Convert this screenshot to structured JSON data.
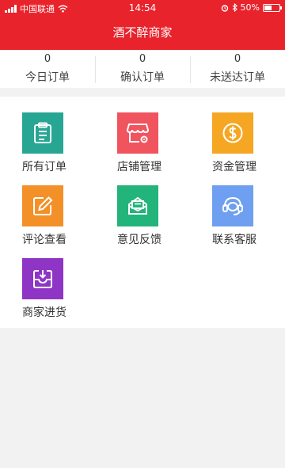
{
  "status_bar": {
    "carrier": "中国联通",
    "time": "14:54",
    "battery": "50%",
    "battery_level": 0.5
  },
  "header": {
    "title": "酒不醉商家"
  },
  "stats": [
    {
      "value": "0",
      "label": "今日订单"
    },
    {
      "value": "0",
      "label": "确认订单"
    },
    {
      "value": "0",
      "label": "未送达订单"
    }
  ],
  "menu": [
    {
      "label": "所有订单",
      "icon": "clipboard-icon",
      "color": "#27a694"
    },
    {
      "label": "店铺管理",
      "icon": "store-icon",
      "color": "#f0545f"
    },
    {
      "label": "资金管理",
      "icon": "dollar-coin-icon",
      "color": "#f5a623"
    },
    {
      "label": "评论查看",
      "icon": "edit-icon",
      "color": "#f39028"
    },
    {
      "label": "意见反馈",
      "icon": "mail-icon",
      "color": "#22b47a"
    },
    {
      "label": "联系客服",
      "icon": "headset-icon",
      "color": "#6e9ff0"
    },
    {
      "label": "商家进货",
      "icon": "inbox-icon",
      "color": "#8f35c6"
    }
  ]
}
